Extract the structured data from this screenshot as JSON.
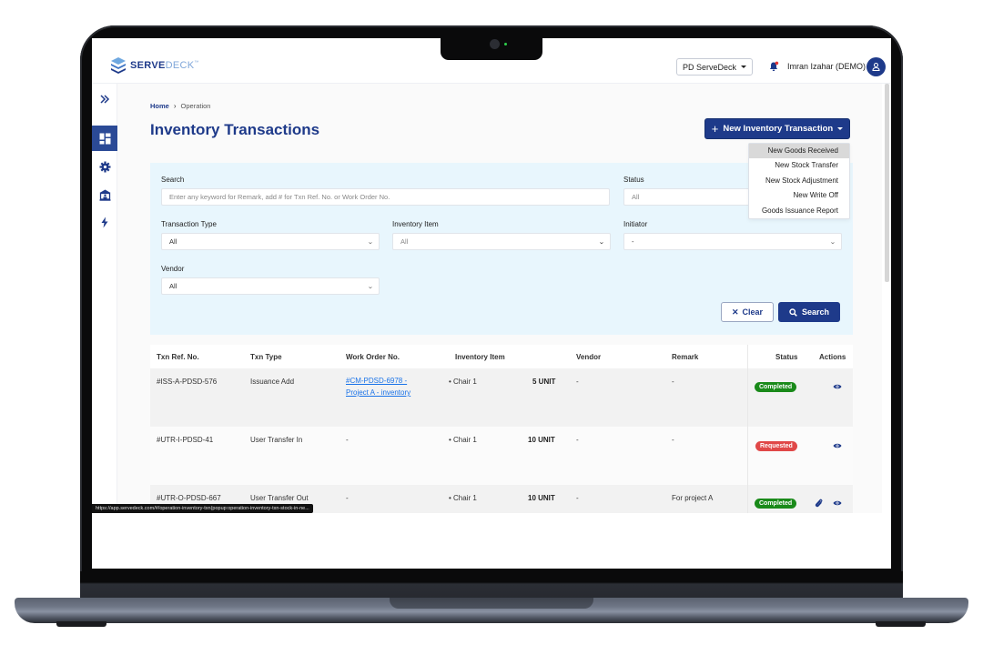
{
  "app": {
    "logo_bold": "SERVE",
    "logo_light": "DECK",
    "logo_tm": "™"
  },
  "topbar": {
    "org_selector": "PD ServeDeck",
    "user_name": "Imran Izahar (DEMO)",
    "notification_dot_color": "#e53935"
  },
  "sidebar": {
    "items": [
      {
        "name": "expand",
        "icon": "double-chevron-right-icon"
      },
      {
        "name": "dashboard",
        "icon": "dashboard-icon",
        "active": true
      },
      {
        "name": "settings",
        "icon": "gear-icon"
      },
      {
        "name": "facility",
        "icon": "building-icon"
      },
      {
        "name": "operation",
        "icon": "lightning-icon"
      }
    ]
  },
  "breadcrumb": {
    "home": "Home",
    "separator": "›",
    "current": "Operation"
  },
  "page": {
    "title": "Inventory Transactions",
    "new_button": "New Inventory Transaction"
  },
  "new_menu": {
    "items": [
      "New Goods Received",
      "New Stock Transfer",
      "New Stock Adjustment",
      "New Write Off",
      "Goods Issuance Report"
    ],
    "hovered_index": 0
  },
  "filters": {
    "search_label": "Search",
    "search_placeholder": "Enter any keyword for Remark, add # for Txn Ref. No. or Work Order No.",
    "status_label": "Status",
    "status_value": "All",
    "txn_type_label": "Transaction Type",
    "txn_type_value": "All",
    "inventory_item_label": "Inventory Item",
    "inventory_item_value": "All",
    "initiator_label": "Initiator",
    "initiator_value": "-",
    "vendor_label": "Vendor",
    "vendor_value": "All",
    "clear_button": "Clear",
    "search_button": "Search"
  },
  "table": {
    "headers": [
      "Txn Ref. No.",
      "Txn Type",
      "Work Order No.",
      "Inventory Item",
      "Vendor",
      "Remark",
      "Status",
      "Actions"
    ],
    "rows": [
      {
        "ref": "#ISS-A-PDSD-576",
        "type": "Issuance Add",
        "work_order_line1": "#CM-PDSD-6978 -",
        "work_order_line2": "Project A - inventory",
        "item": "Chair 1",
        "qty": "5 UNIT",
        "vendor": "-",
        "remark": "-",
        "status": "Completed",
        "status_color": "#1a8a1a",
        "has_attachment": false
      },
      {
        "ref": "#UTR-I-PDSD-41",
        "type": "User Transfer In",
        "work_order_line1": "-",
        "work_order_line2": "",
        "item": "Chair 1",
        "qty": "10 UNIT",
        "vendor": "-",
        "remark": "-",
        "status": "Requested",
        "status_color": "#e04848",
        "has_attachment": false
      },
      {
        "ref": "#UTR-O-PDSD-667",
        "type": "User Transfer Out",
        "work_order_line1": "-",
        "work_order_line2": "",
        "item": "Chair 1",
        "qty": "10 UNIT",
        "vendor": "-",
        "remark": "For project A",
        "status": "Completed",
        "status_color": "#1a8a1a",
        "has_attachment": true
      }
    ]
  },
  "status_bar_url": "https://app.servedeck.com/#/operation-inventory-txn(popup:operation-inventory-txn-stock-in-ne..."
}
